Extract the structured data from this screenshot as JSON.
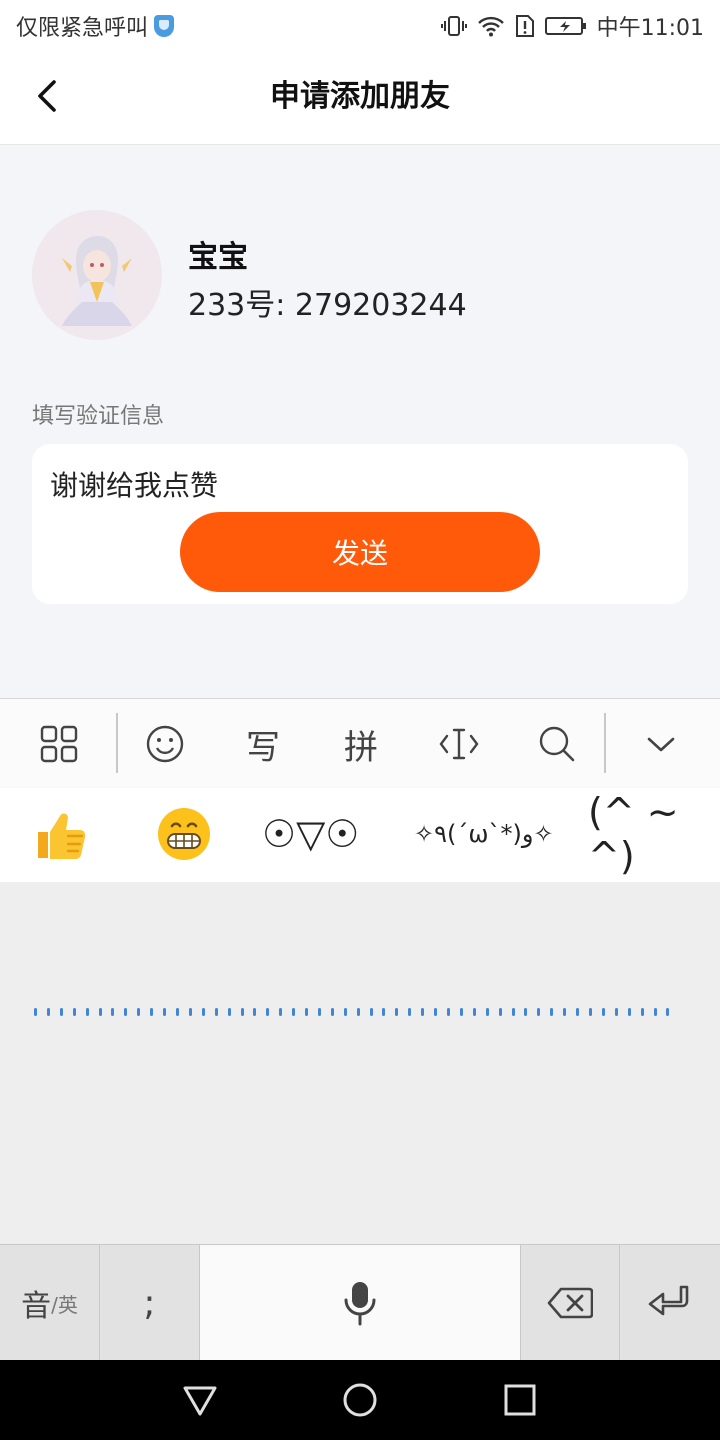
{
  "status_bar": {
    "left_text": "仅限紧急呼叫",
    "time": "中午11:01"
  },
  "header": {
    "title": "申请添加朋友"
  },
  "profile": {
    "name": "宝宝",
    "account": "233号: 279203244"
  },
  "verify": {
    "label": "填写验证信息",
    "message": "谢谢给我点赞",
    "send_label": "发送"
  },
  "keyboard": {
    "toolbar": {
      "write_label": "写",
      "pinyin_label": "拼"
    },
    "suggestions": [
      "☉▽☉",
      "✧٩(ˊωˋ*)و✧",
      "(^ ~ ^)"
    ],
    "bottom": {
      "lang_main": "音",
      "lang_sub": "/英",
      "semicolon": ";"
    }
  },
  "colors": {
    "accent": "#ff5a0a",
    "handwriting_dots": "#3f86d6"
  }
}
